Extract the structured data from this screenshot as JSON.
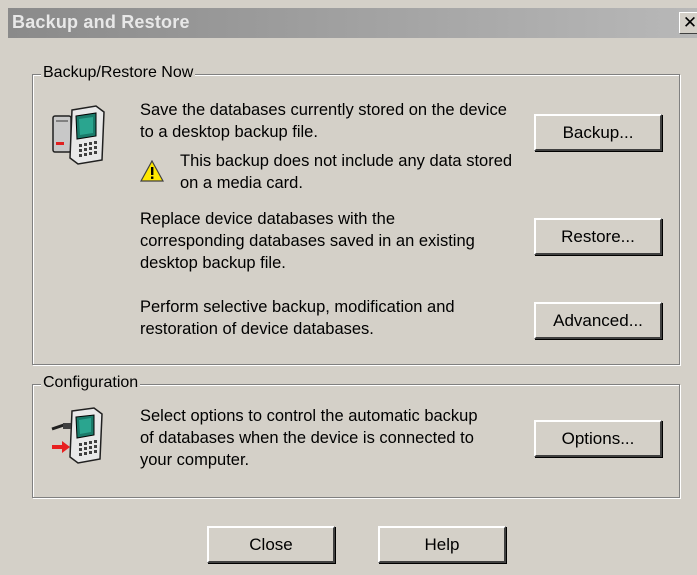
{
  "window": {
    "title": "Backup and Restore",
    "close_glyph": "✕"
  },
  "backup_restore_group": {
    "legend": "Backup/Restore Now",
    "device_icon": "handheld-device-icon",
    "backup": {
      "description": "Save the databases currently stored on the device to a desktop backup file.",
      "button_label": "Backup..."
    },
    "warning": {
      "icon": "warning-icon",
      "text": "This backup does not include any data stored on a media card."
    },
    "restore": {
      "description": "Replace device databases with the corresponding databases saved in an existing desktop backup file.",
      "button_label": "Restore..."
    },
    "advanced": {
      "description": "Perform selective backup, modification and restoration of device databases.",
      "button_label": "Advanced..."
    }
  },
  "configuration_group": {
    "legend": "Configuration",
    "device_icon": "device-connection-icon",
    "description": "Select options to control the automatic backup of databases when the device is connected to your computer.",
    "button_label": "Options..."
  },
  "footer": {
    "close_label": "Close",
    "help_label": "Help"
  },
  "colors": {
    "dialog_bg": "#d4d0c8",
    "titlebar_start": "#8a8a8a",
    "titlebar_end": "#b8b8b8",
    "title_text": "#e8e8e8"
  }
}
